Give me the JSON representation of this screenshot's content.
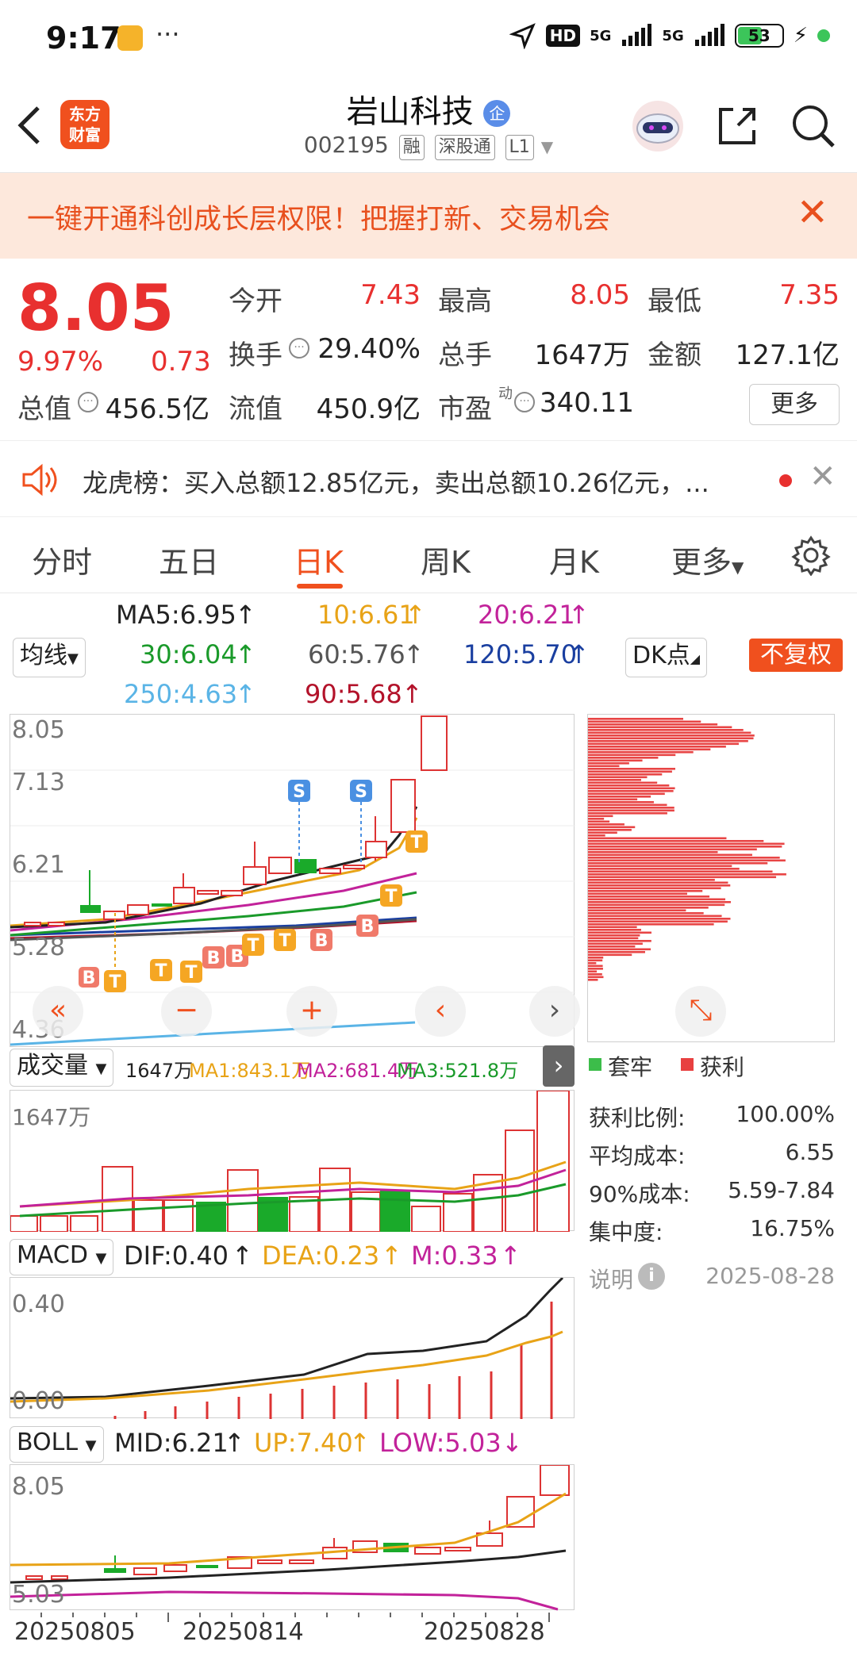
{
  "status": {
    "time": "9:17",
    "battery": "53",
    "net1": "5G",
    "net2": "5G",
    "hd": "HD"
  },
  "header": {
    "brand_line1": "东方",
    "brand_line2": "财富",
    "title": "岩山科技",
    "badge": "企",
    "code": "002195",
    "tags": [
      "融",
      "深股通",
      "L1"
    ]
  },
  "banner": {
    "text": "一键开通科创成长层权限！把握打新、交易机会"
  },
  "quote": {
    "price": "8.05",
    "pct": "9.97%",
    "chg": "0.73",
    "rows": [
      [
        {
          "l": "今开",
          "v": "7.43",
          "red": true
        },
        {
          "l": "最高",
          "v": "8.05",
          "red": true
        },
        {
          "l": "最低",
          "v": "7.35",
          "red": true
        }
      ],
      [
        {
          "l": "换手",
          "v": "29.40%",
          "red": false
        },
        {
          "l": "总手",
          "v": "1647万",
          "red": false
        },
        {
          "l": "金额",
          "v": "127.1亿",
          "red": false
        }
      ]
    ],
    "total_value_label": "总值",
    "total_value": "456.5亿",
    "float_value_label": "流值",
    "float_value": "450.9亿",
    "pe_label": "市盈",
    "pe_sup": "动",
    "pe_value": "340.11",
    "more": "更多"
  },
  "dragon": {
    "text": "龙虎榜：买入总额12.85亿元，卖出总额10.26亿元，..."
  },
  "tabs": [
    "分时",
    "五日",
    "日K",
    "周K",
    "月K",
    "更多"
  ],
  "ma": {
    "ma5": "MA5:6.95",
    "ma10": "10:6.61",
    "ma20": "20:6.21",
    "ma30": "30:6.04",
    "ma60": "60:5.76",
    "ma120": "120:5.70",
    "ma250": "250:4.63",
    "ma90": "90:5.68",
    "selector": "均线",
    "dk": "DK点",
    "fq": "不复权",
    "colors": {
      "ma5": "#222222",
      "ma10": "#e8a317",
      "ma20": "#c2229a",
      "ma30": "#1a9a2a",
      "ma60": "#555555",
      "ma120": "#1a3fa0",
      "ma250": "#5ab4e6",
      "ma90": "#b3122a"
    }
  },
  "kline": {
    "ticks": [
      "8.05",
      "7.13",
      "6.21",
      "5.28",
      "4.36"
    ]
  },
  "volume": {
    "selector": "成交量",
    "v": "1647万",
    "ma1": "MA1:843.1万",
    "ma2": "MA2:681.4万",
    "ma3": "MA3:521.8万",
    "axis": "1647万"
  },
  "macd": {
    "selector": "MACD",
    "dif": "DIF:0.40",
    "dea": "DEA:0.23",
    "m": "M:0.33",
    "top": "0.40",
    "bottom": "0.00"
  },
  "boll": {
    "selector": "BOLL",
    "mid": "MID:6.21",
    "up": "UP:7.40",
    "low": "LOW:5.03",
    "top": "8.05",
    "bottom": "5.03"
  },
  "dates": [
    "20250805",
    "20250814",
    "20250828"
  ],
  "chips": {
    "legend_trap": "套牢",
    "legend_profit": "获利",
    "stats": [
      {
        "l": "获利比例:",
        "v": "100.00%"
      },
      {
        "l": "平均成本:",
        "v": "6.55"
      },
      {
        "l": "90%成本:",
        "v": "5.59-7.84"
      },
      {
        "l": "集中度:",
        "v": "16.75%"
      }
    ],
    "note": "说明",
    "date": "2025-08-28"
  },
  "signals": {
    "B": "B",
    "T": "T",
    "S": "S"
  }
}
